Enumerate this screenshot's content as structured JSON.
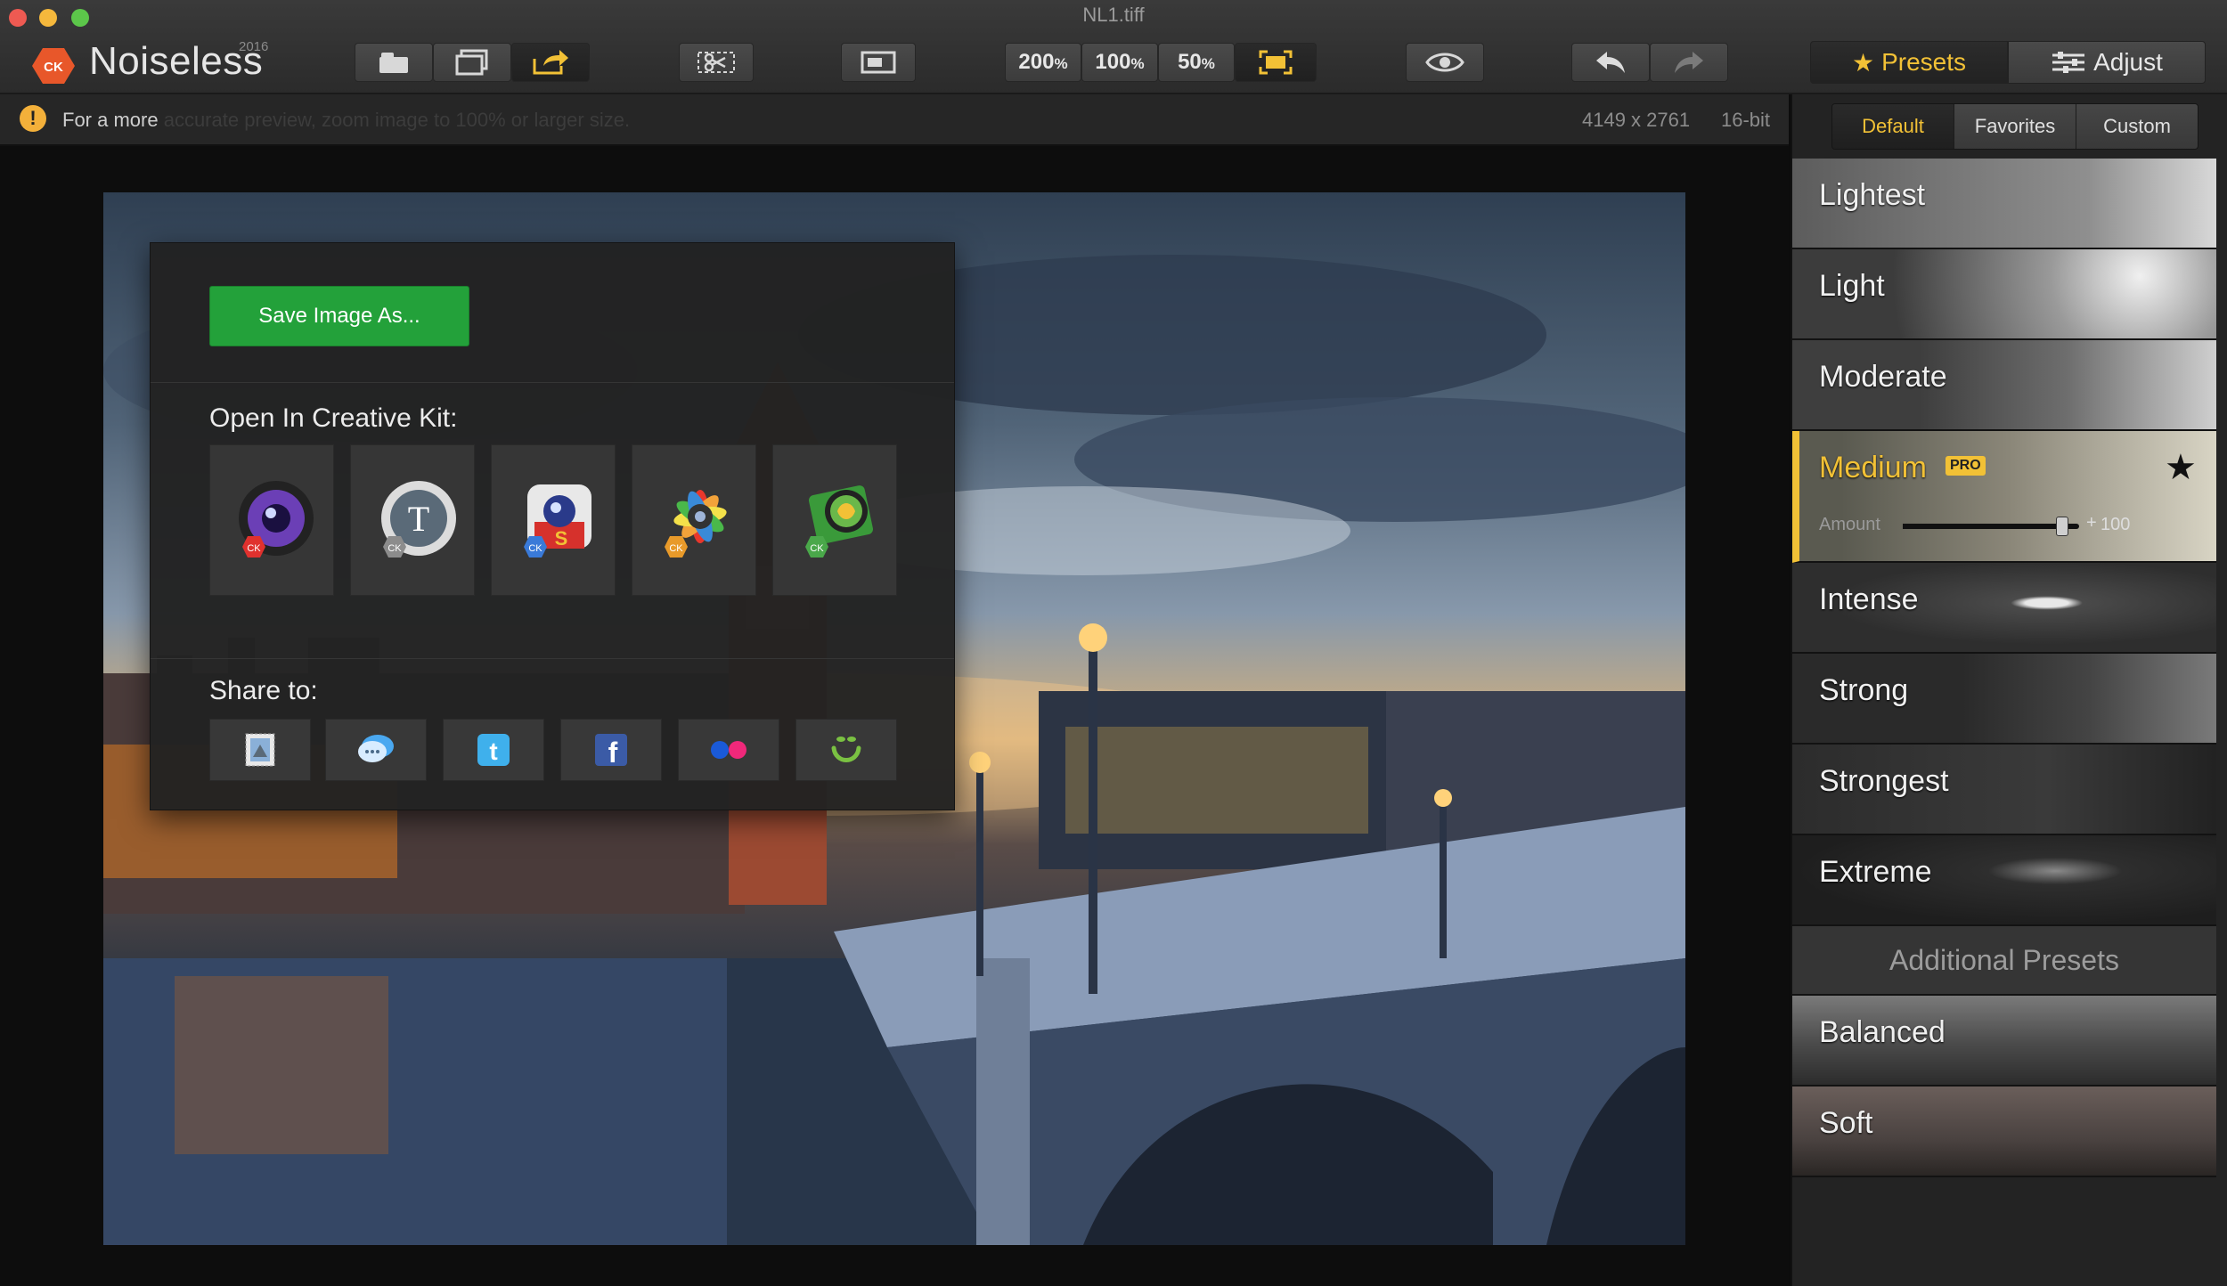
{
  "window": {
    "title": "NL1.tiff"
  },
  "app": {
    "name": "Noiseless",
    "year": "2016",
    "logo_text": "CK"
  },
  "toolbar": {
    "zoom_200": {
      "num": "200",
      "unit": "%"
    },
    "zoom_100": {
      "num": "100",
      "unit": "%"
    },
    "zoom_50": {
      "num": "50",
      "unit": "%"
    },
    "presets_tab": "Presets",
    "adjust_tab": "Adjust"
  },
  "infobar": {
    "warning_text": "For a more",
    "warning_text_hidden": " accurate preview, zoom image to 100% or larger size.",
    "dimensions": "4149 x 2761",
    "bit_depth": "16-bit"
  },
  "share_popover": {
    "save_button": "Save Image As...",
    "creative_kit_heading": "Open In Creative Kit:",
    "kit_badge": "CK",
    "kit_apps": [
      "focus-app",
      "tonality-app",
      "snapheal-app",
      "intensify-app",
      "photolemur-app"
    ],
    "share_heading": "Share to:",
    "share_targets": [
      "mail",
      "messages",
      "twitter",
      "facebook",
      "flickr",
      "smugmug"
    ]
  },
  "sidebar": {
    "tabs": [
      "Default",
      "Favorites",
      "Custom"
    ],
    "active_tab": "Default",
    "presets": [
      "Lightest",
      "Light",
      "Moderate",
      "Medium",
      "Intense",
      "Strong",
      "Strongest",
      "Extreme"
    ],
    "selected_preset": {
      "name": "Medium",
      "badge": "PRO",
      "amount_label": "Amount",
      "amount_plus": "+",
      "amount_value": "100",
      "amount_fraction": 0.9
    },
    "additional_header": "Additional Presets",
    "additional_presets": [
      "Balanced",
      "Soft"
    ]
  },
  "colors": {
    "accent": "#f2c136",
    "save_green": "#23a13a",
    "logo_orange": "#e8572a"
  }
}
